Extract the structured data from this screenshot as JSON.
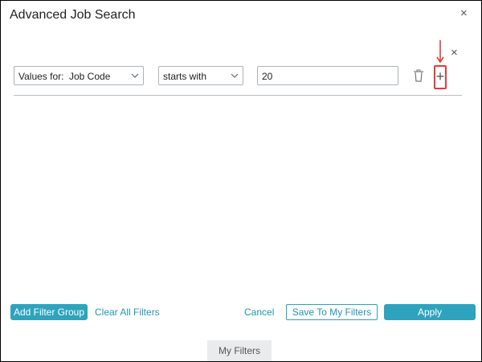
{
  "dialog": {
    "title": "Advanced Job Search",
    "close_glyph": "×"
  },
  "filter_row": {
    "values_label": "Values for:",
    "values_selected": "Job Code",
    "operator_selected": "starts with",
    "input_value": "20",
    "remove_glyph": "×",
    "add_glyph": "+"
  },
  "footer": {
    "add_filter_group": "Add Filter Group",
    "clear_all_filters": "Clear All Filters",
    "cancel": "Cancel",
    "save_to_my_filters": "Save To My Filters",
    "apply": "Apply"
  },
  "tabs": {
    "my_filters": "My Filters"
  },
  "colors": {
    "accent": "#2ea3bd",
    "link": "#2196b3",
    "highlight": "#e53b3b"
  },
  "icons": [
    "close-icon",
    "chevron-down-icon",
    "trash-icon",
    "plus-icon",
    "arrow-down-icon"
  ]
}
